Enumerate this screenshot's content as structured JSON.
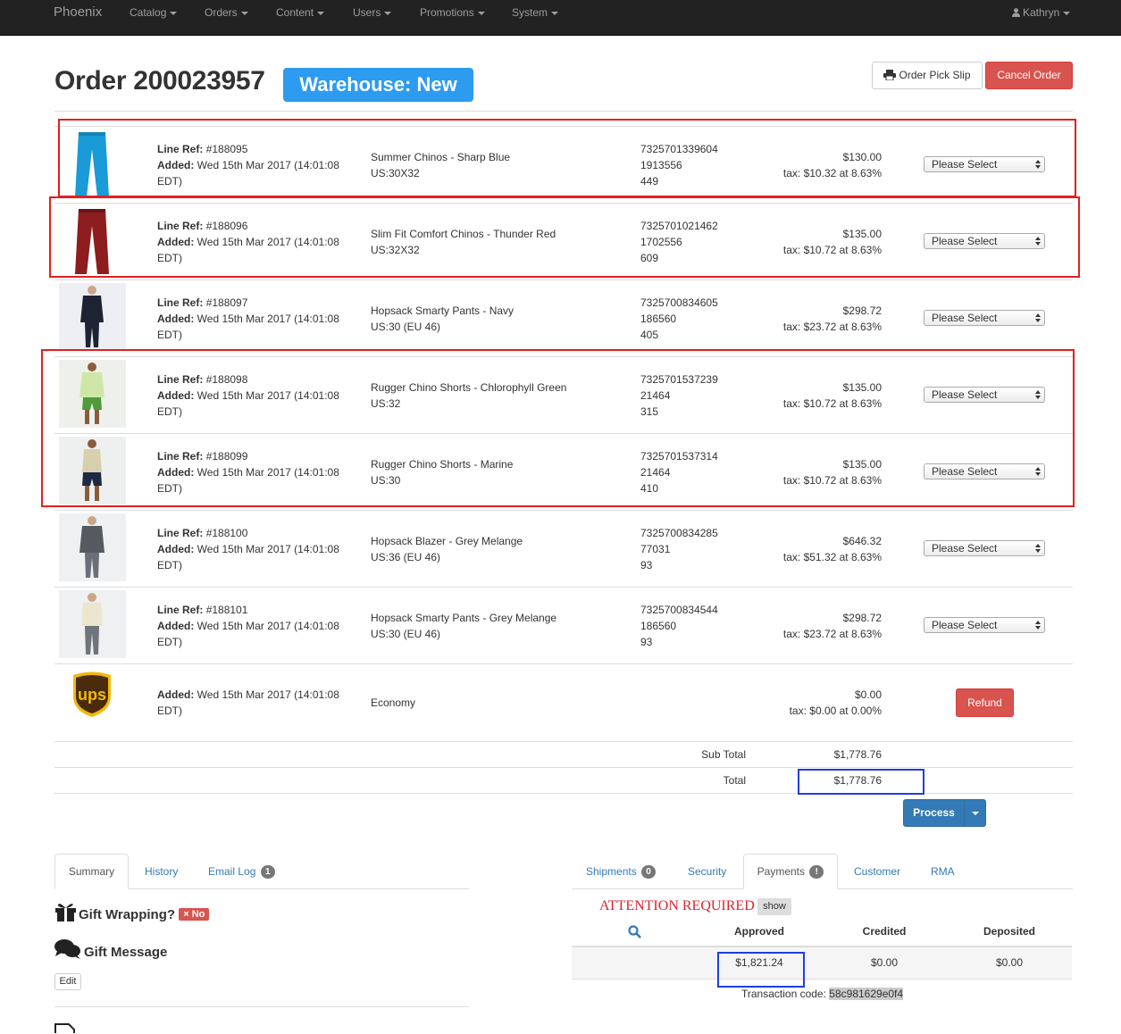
{
  "navbar": {
    "brand": "Phoenix",
    "menu": [
      "Catalog",
      "Orders",
      "Content",
      "Users",
      "Promotions",
      "System"
    ],
    "user": "Kathryn"
  },
  "header": {
    "title": "Order 200023957",
    "warehouse_badge": "Warehouse: New",
    "pick_slip_label": "Order Pick Slip",
    "cancel_label": "Cancel Order"
  },
  "common": {
    "line_ref_label": "Line Ref:",
    "added_label": "Added:",
    "select_placeholder": "Please Select"
  },
  "lines": [
    {
      "ref": "#188095",
      "added_1": "Wed 15th Mar 2017 (14:01:08",
      "added_2": "EDT)",
      "product": "Summer Chinos - Sharp Blue",
      "size": "US:30X32",
      "code1": "7325701339604",
      "code2": "1913556",
      "code3": "449",
      "price": "$130.00",
      "tax": "tax: $10.32 at 8.63%",
      "thumb": "blue-chinos"
    },
    {
      "ref": "#188096",
      "added_1": "Wed 15th Mar 2017 (14:01:08",
      "added_2": "EDT)",
      "product": "Slim Fit Comfort Chinos - Thunder Red",
      "size": "US:32X32",
      "code1": "7325701021462",
      "code2": "1702556",
      "code3": "609",
      "price": "$135.00",
      "tax": "tax: $10.72 at 8.63%",
      "thumb": "red-chinos"
    },
    {
      "ref": "#188097",
      "added_1": "Wed 15th Mar 2017 (14:01:08",
      "added_2": "EDT)",
      "product": "Hopsack Smarty Pants - Navy",
      "size": "US:30 (EU 46)",
      "code1": "7325700834605",
      "code2": "186560",
      "code3": "405",
      "price": "$298.72",
      "tax": "tax: $23.72 at 8.63%",
      "thumb": "navy-suit-model"
    },
    {
      "ref": "#188098",
      "added_1": "Wed 15th Mar 2017 (14:01:08",
      "added_2": "EDT)",
      "product": "Rugger Chino Shorts - Chlorophyll Green",
      "size": "US:32",
      "code1": "7325701537239",
      "code2": "21464",
      "code3": "315",
      "price": "$135.00",
      "tax": "tax: $10.72 at 8.63%",
      "thumb": "green-shorts-model"
    },
    {
      "ref": "#188099",
      "added_1": "Wed 15th Mar 2017 (14:01:08",
      "added_2": "EDT)",
      "product": "Rugger Chino Shorts - Marine",
      "size": "US:30",
      "code1": "7325701537314",
      "code2": "21464",
      "code3": "410",
      "price": "$135.00",
      "tax": "tax: $10.72 at 8.63%",
      "thumb": "marine-shorts-model"
    },
    {
      "ref": "#188100",
      "added_1": "Wed 15th Mar 2017 (14:01:08",
      "added_2": "EDT)",
      "product": "Hopsack Blazer - Grey Melange",
      "size": "US:36 (EU 46)",
      "code1": "7325700834285",
      "code2": "77031",
      "code3": "93",
      "price": "$646.32",
      "tax": "tax: $51.32 at 8.63%",
      "thumb": "grey-blazer-model"
    },
    {
      "ref": "#188101",
      "added_1": "Wed 15th Mar 2017 (14:01:08",
      "added_2": "EDT)",
      "product": "Hopsack Smarty Pants - Grey Melange",
      "size": "US:30 (EU 46)",
      "code1": "7325700834544",
      "code2": "186560",
      "code3": "93",
      "price": "$298.72",
      "tax": "tax: $23.72 at 8.63%",
      "thumb": "grey-pants-model"
    }
  ],
  "shipping": {
    "logo": "ups-logo",
    "added_1": "Wed 15th Mar 2017 (14:01:08",
    "added_2": "EDT)",
    "method": "Economy",
    "price": "$0.00",
    "tax": "tax: $0.00 at 0.00%",
    "refund_label": "Refund"
  },
  "totals": {
    "subtotal_label": "Sub Total",
    "subtotal": "$1,778.76",
    "total_label": "Total",
    "total": "$1,778.76",
    "process_label": "Process"
  },
  "left_tabs": {
    "tabs": [
      "Summary",
      "History",
      "Email Log"
    ],
    "email_log_count": "1",
    "gift_wrapping_label": "Gift Wrapping?",
    "gift_wrapping_value": "No",
    "gift_message_label": "Gift Message",
    "edit_label": "Edit"
  },
  "right_tabs": {
    "tabs": [
      "Shipments",
      "Security",
      "Payments",
      "Customer",
      "RMA"
    ],
    "shipments_count": "0",
    "payments_badge": "!",
    "attention": "ATTENTION REQUIRED",
    "show_label": "show",
    "columns": [
      "Approved",
      "Credited",
      "Deposited"
    ],
    "approved": "$1,821.24",
    "credited": "$0.00",
    "deposited": "$0.00",
    "transaction_label": "Transaction code:",
    "transaction_code": "58c981629e0f4"
  },
  "colors": {
    "navbar": "#222222",
    "warehouse_badge": "#2d9bf0",
    "danger": "#d9534f",
    "primary": "#337ab7",
    "highlight_red": "#e02020",
    "highlight_blue": "#1f3ee0"
  }
}
